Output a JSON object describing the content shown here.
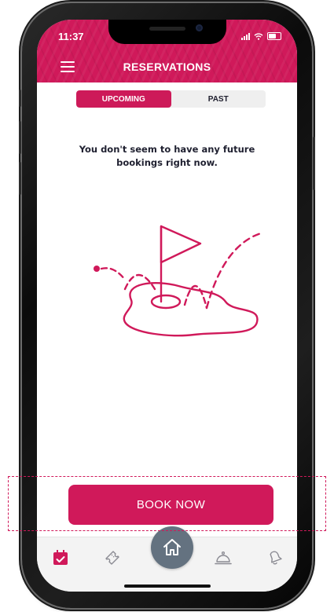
{
  "status_bar": {
    "time": "11:37"
  },
  "header": {
    "title": "RESERVATIONS",
    "menu_icon": "hamburger-menu-icon"
  },
  "tabs": [
    {
      "label": "UPCOMING",
      "active": true
    },
    {
      "label": "PAST",
      "active": false
    }
  ],
  "empty_state": {
    "message": "You don't seem to have any future bookings right now.",
    "illustration": "golf-flag-hole-illustration"
  },
  "primary_action": {
    "label": "BOOK NOW"
  },
  "bottom_nav": {
    "items": [
      {
        "icon": "calendar-check-icon",
        "active": true
      },
      {
        "icon": "ticket-icon",
        "active": false
      },
      {
        "icon": "home-icon",
        "active": false
      },
      {
        "icon": "service-bell-icon",
        "active": false
      },
      {
        "icon": "notification-bell-icon",
        "active": false
      }
    ]
  },
  "colors": {
    "brand": "#d0195a",
    "home_button": "#647280",
    "text_dark": "#1f2030"
  }
}
